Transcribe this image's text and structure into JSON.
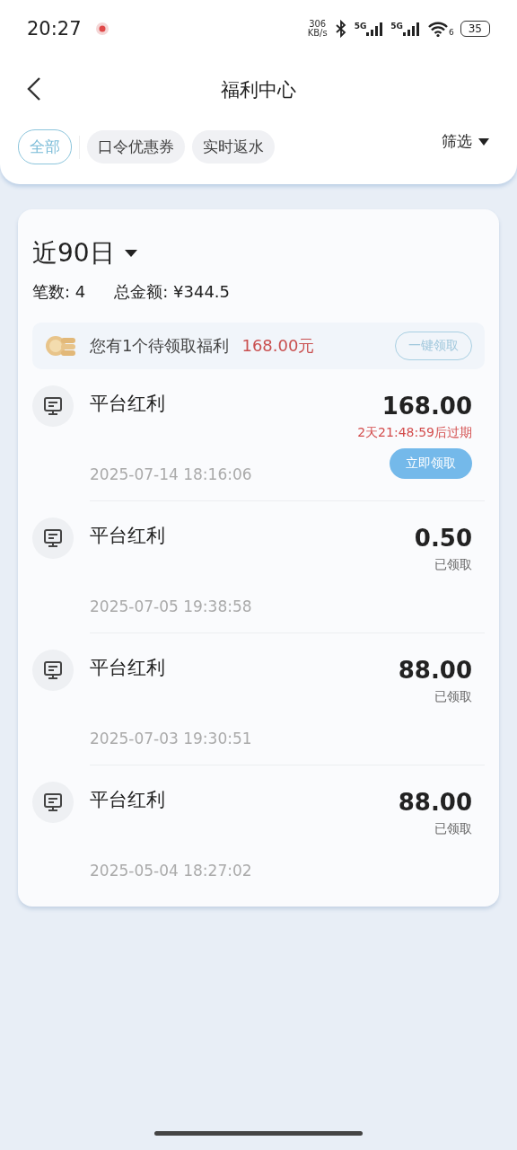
{
  "status_bar": {
    "time": "20:27",
    "speed_value": "306",
    "speed_unit": "KB/s",
    "sim1": "5G",
    "sim2": "5G",
    "wifi_index": "6",
    "battery": "35"
  },
  "header": {
    "title": "福利中心"
  },
  "tabs": [
    {
      "label": "全部",
      "selected": true
    },
    {
      "label": "口令优惠券",
      "selected": false
    },
    {
      "label": "实时返水",
      "selected": false
    }
  ],
  "filter": {
    "label": "筛选"
  },
  "summary": {
    "period": "近90日",
    "count": "笔数: 4",
    "total": "总金额: ¥344.5"
  },
  "banner": {
    "text": "您有1个待领取福利",
    "amount": "168.00元",
    "button": "一键领取"
  },
  "records": [
    {
      "kind": "pending",
      "title": "平台红利",
      "amount": "168.00",
      "expiry": "2天21:48:59后过期",
      "button": "立即领取",
      "time": "2025-07-14 18:16:06"
    },
    {
      "kind": "claimed",
      "title": "平台红利",
      "amount": "0.50",
      "status": "已领取",
      "time": "2025-07-05 19:38:58"
    },
    {
      "kind": "claimed",
      "title": "平台红利",
      "amount": "88.00",
      "status": "已领取",
      "time": "2025-07-03 19:30:51"
    },
    {
      "kind": "claimed",
      "title": "平台红利",
      "amount": "88.00",
      "status": "已领取",
      "time": "2025-05-04 18:27:02"
    }
  ]
}
